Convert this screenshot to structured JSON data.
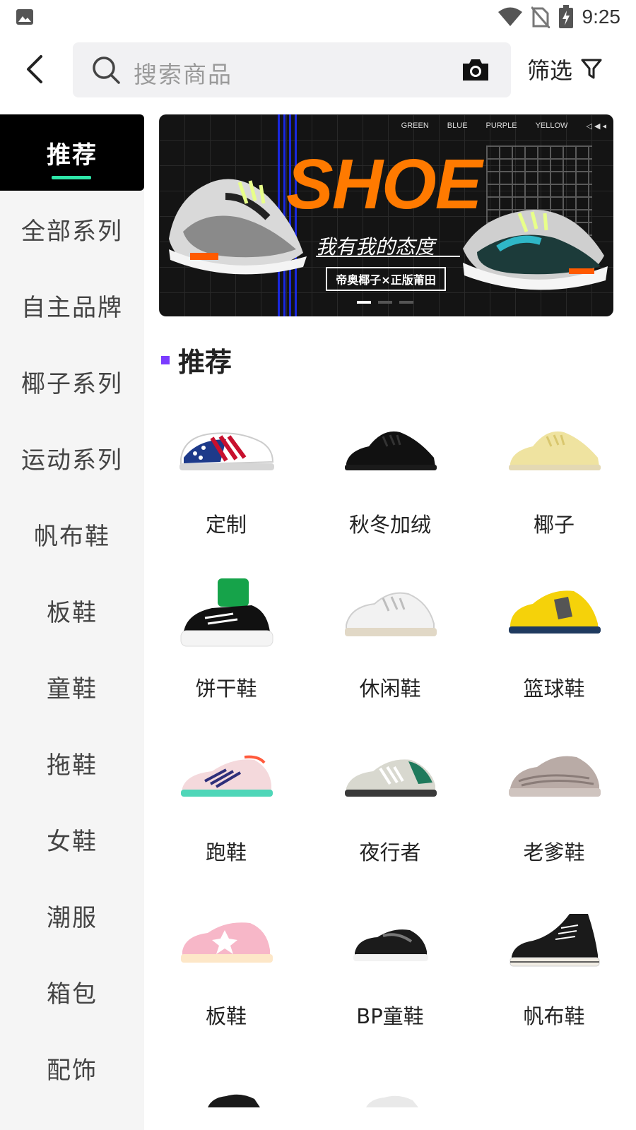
{
  "status": {
    "time": "9:25"
  },
  "search": {
    "placeholder": "搜索商品"
  },
  "filter": {
    "label": "筛选"
  },
  "sidebar": {
    "items": [
      {
        "label": "推荐",
        "active": true
      },
      {
        "label": "全部系列"
      },
      {
        "label": "自主品牌"
      },
      {
        "label": "椰子系列"
      },
      {
        "label": "运动系列"
      },
      {
        "label": "帆布鞋"
      },
      {
        "label": "板鞋"
      },
      {
        "label": "童鞋"
      },
      {
        "label": "拖鞋"
      },
      {
        "label": "女鞋"
      },
      {
        "label": "潮服"
      },
      {
        "label": "箱包"
      },
      {
        "label": "配饰"
      }
    ]
  },
  "banner": {
    "colors": [
      "GREEN",
      "BLUE",
      "PURPLE",
      "YELLOW"
    ],
    "headline": "SHOE",
    "subtitle": "我有我的态度",
    "tag": "帝奥椰子×正版莆田",
    "accent": "#ff7a00"
  },
  "section": {
    "title": "推荐",
    "mark_color": "#7b3cff"
  },
  "categories": [
    {
      "label": "定制",
      "icon": "custom-shoe-icon"
    },
    {
      "label": "秋冬加绒",
      "icon": "black-sneaker-icon"
    },
    {
      "label": "椰子",
      "icon": "yeezy-sneaker-icon"
    },
    {
      "label": "饼干鞋",
      "icon": "sock-sneaker-icon"
    },
    {
      "label": "休闲鞋",
      "icon": "white-sneaker-icon"
    },
    {
      "label": "篮球鞋",
      "icon": "yellow-basketball-shoe-icon"
    },
    {
      "label": "跑鞋",
      "icon": "running-shoe-icon"
    },
    {
      "label": "夜行者",
      "icon": "nite-jogger-icon"
    },
    {
      "label": "老爹鞋",
      "icon": "dad-shoe-icon"
    },
    {
      "label": "板鞋",
      "icon": "pink-skate-shoe-icon"
    },
    {
      "label": "BP童鞋",
      "icon": "kids-shoe-icon"
    },
    {
      "label": "帆布鞋",
      "icon": "canvas-shoe-icon"
    }
  ]
}
